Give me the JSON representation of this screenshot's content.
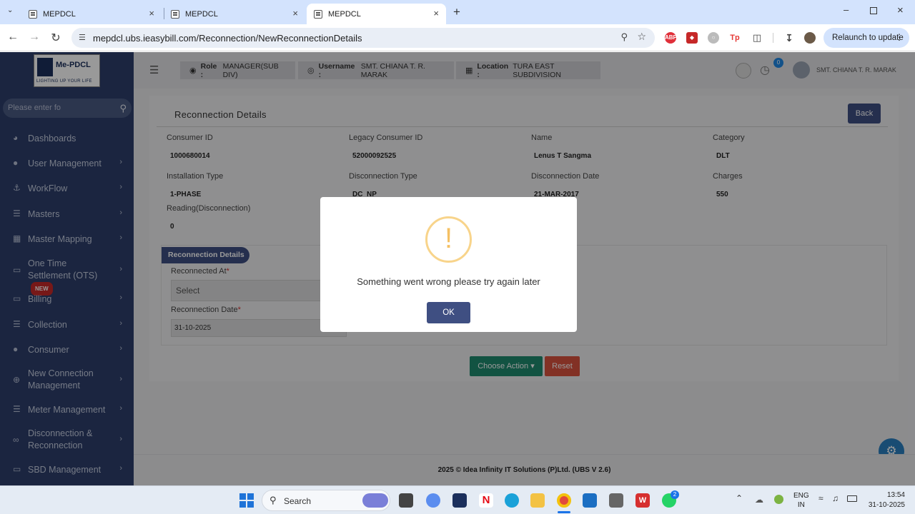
{
  "browser": {
    "tabs": [
      {
        "title": "MEPDCL"
      },
      {
        "title": "MEPDCL"
      },
      {
        "title": "MEPDCL"
      }
    ],
    "url": "mepdcl.ubs.ieasybill.com/Reconnection/NewReconnectionDetails",
    "relaunch_label": "Relaunch to update"
  },
  "logo": {
    "name": "Me-PDCL",
    "tagline": "LIGHTING UP YOUR LIFE"
  },
  "sidebar": {
    "search_placeholder": "Please enter fo",
    "new_badge": "NEW",
    "items": [
      {
        "label": "Dashboards",
        "icon": "gauge-icon",
        "chevron": false
      },
      {
        "label": "User Management",
        "icon": "user-icon",
        "chevron": true
      },
      {
        "label": "WorkFlow",
        "icon": "anchor-icon",
        "chevron": true
      },
      {
        "label": "Masters",
        "icon": "list-icon",
        "chevron": true
      },
      {
        "label": "Master Mapping",
        "icon": "sitemap-icon",
        "chevron": true
      },
      {
        "label": "One Time Settlement (OTS)",
        "icon": "monitor-icon",
        "chevron": true
      },
      {
        "label": "Billing",
        "icon": "monitor-icon",
        "chevron": true
      },
      {
        "label": "Collection",
        "icon": "list-icon",
        "chevron": true
      },
      {
        "label": "Consumer",
        "icon": "user-icon",
        "chevron": true
      },
      {
        "label": "New Connection Management",
        "icon": "plus-circle-icon",
        "chevron": true
      },
      {
        "label": "Meter Management",
        "icon": "list-icon",
        "chevron": true
      },
      {
        "label": "Disconnection & Reconnection",
        "icon": "link-icon",
        "chevron": true
      },
      {
        "label": "SBD Management",
        "icon": "file-icon",
        "chevron": true
      }
    ]
  },
  "header": {
    "role_label": "Role :",
    "role_value": "MANAGER(SUB DIV)",
    "username_label": "Username :",
    "username_value": "SMT. CHIANA T. R. MARAK",
    "location_label": "Location :",
    "location_value": "TURA EAST SUBDIVISION",
    "notif_count": "0",
    "user_display": "SMT. CHIANA T. R. MARAK"
  },
  "details": {
    "title": "Reconnection Details",
    "back_label": "Back",
    "fields": [
      {
        "label": "Consumer ID",
        "value": "1000680014"
      },
      {
        "label": "Legacy Consumer ID",
        "value": "52000092525"
      },
      {
        "label": "Name",
        "value": "Lenus T Sangma"
      },
      {
        "label": "Category",
        "value": "DLT"
      },
      {
        "label": "Installation Type",
        "value": "1-PHASE"
      },
      {
        "label": "Disconnection Type",
        "value": "DC_NP"
      },
      {
        "label": "Disconnection Date",
        "value": "21-MAR-2017"
      },
      {
        "label": "Charges",
        "value": "550"
      },
      {
        "label": "Reading(Disconnection)",
        "value": "0"
      }
    ],
    "section_title": "Reconnection Details",
    "reconnected_at_label": "Reconnected At",
    "reconnected_at_value": "Select",
    "reconnection_date_label": "Reconnection Date",
    "reconnection_date_value": "31-10-2025",
    "required_mark": "*",
    "choose_action_label": "Choose Action",
    "reset_label": "Reset"
  },
  "footer": {
    "text": "2025 © Idea Infinity IT Solutions (P)Ltd. (UBS V 2.6)"
  },
  "modal": {
    "message": "Something went wrong please try again later",
    "ok_label": "OK",
    "icon": "exclamation-icon"
  },
  "taskbar": {
    "search_label": "Search",
    "lang_primary": "ENG",
    "lang_secondary": "IN",
    "time": "13:54",
    "date": "31-10-2025",
    "whatsapp_badge": "2"
  }
}
